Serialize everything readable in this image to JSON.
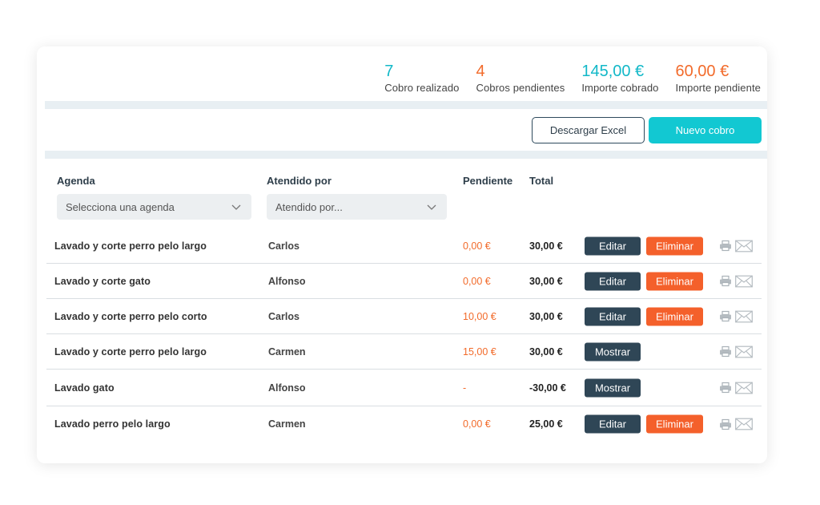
{
  "stats": [
    {
      "value": "7",
      "label": "Cobro realizado",
      "color": "#12b8c8"
    },
    {
      "value": "4",
      "label": "Cobros pendientes",
      "color": "#f26b2b"
    },
    {
      "value": "145,00 €",
      "label": "Importe cobrado",
      "color": "#12b8c8"
    },
    {
      "value": "60,00 €",
      "label": "Importe pendiente",
      "color": "#f26b2b"
    }
  ],
  "toolbar": {
    "excel_label": "Descargar Excel",
    "new_label": "Nuevo cobro"
  },
  "table": {
    "headers": {
      "agenda": "Agenda",
      "atendido": "Atendido por",
      "pendiente": "Pendiente",
      "total": "Total"
    },
    "filters": {
      "agenda_placeholder": "Selecciona una agenda",
      "atendido_placeholder": "Atendido por..."
    },
    "rows": [
      {
        "service": "Lavado y corte perro pelo largo",
        "agent": "Carlos",
        "pending": "0,00 €",
        "total": "30,00 €",
        "actions": [
          "Editar",
          "Eliminar"
        ]
      },
      {
        "service": "Lavado y corte gato",
        "agent": "Alfonso",
        "pending": "0,00 €",
        "total": "30,00 €",
        "actions": [
          "Editar",
          "Eliminar"
        ]
      },
      {
        "service": "Lavado y corte perro pelo corto",
        "agent": "Carlos",
        "pending": "10,00 €",
        "total": "30,00 €",
        "actions": [
          "Editar",
          "Eliminar"
        ]
      },
      {
        "service": "Lavado y corte perro pelo largo",
        "agent": "Carmen",
        "pending": "15,00 €",
        "total": "30,00 €",
        "actions": [
          "Mostrar"
        ]
      },
      {
        "service": "Lavado gato",
        "agent": "Alfonso",
        "pending": "-",
        "total": "-30,00 €",
        "actions": [
          "Mostrar"
        ]
      },
      {
        "service": "Lavado perro pelo largo",
        "agent": "Carmen",
        "pending": "0,00 €",
        "total": "25,00 €",
        "actions": [
          "Editar",
          "Eliminar"
        ]
      }
    ],
    "row_icons": [
      "printer-icon",
      "mail-icon"
    ]
  },
  "colors": {
    "accent_teal": "#12c8d2",
    "danger_orange": "#f4602b",
    "dark_button": "#2f4656"
  }
}
